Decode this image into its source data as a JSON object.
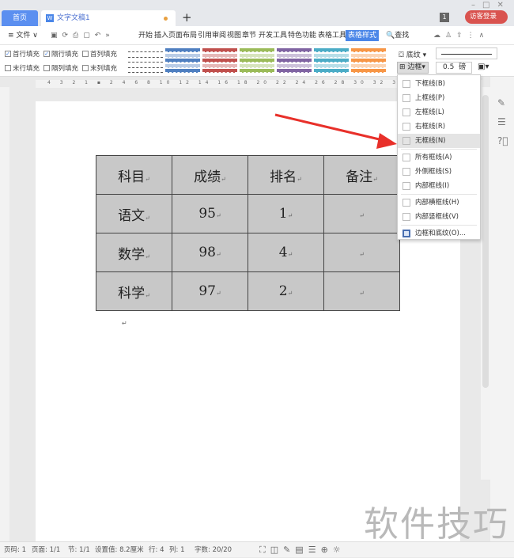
{
  "tabs": {
    "home": "首页",
    "doc": "文字文稿1",
    "new": "+"
  },
  "window": {
    "badge": "1",
    "login": "访客登录"
  },
  "menu": {
    "file": "≡ 文件 ∨",
    "items": [
      "开始",
      "插入",
      "页面布局",
      "引用",
      "审阅",
      "视图",
      "章节",
      "开发工具",
      "特色功能",
      "表格工具",
      "表格样式"
    ],
    "active": "表格样式",
    "search": "查找"
  },
  "toolbar": {
    "checks": [
      {
        "label": "首行填充",
        "checked": true
      },
      {
        "label": "隔行填充",
        "checked": true
      },
      {
        "label": "首列填充",
        "checked": false
      },
      {
        "label": "末行填充",
        "checked": false
      },
      {
        "label": "隔列填充",
        "checked": false
      },
      {
        "label": "末列填充",
        "checked": false
      }
    ],
    "style_colors": [
      "#ffffff",
      "#4f7fc0",
      "#c0504d",
      "#9bbb59",
      "#8064a2",
      "#4bacc6",
      "#f79646"
    ],
    "shading": "底纹",
    "border": "边框",
    "line_width": "0.5",
    "unit": "磅"
  },
  "table": {
    "rows": [
      [
        "科目",
        "成绩",
        "排名",
        "备注"
      ],
      [
        "语文",
        "95",
        "1",
        ""
      ],
      [
        "数学",
        "98",
        "4",
        ""
      ],
      [
        "科学",
        "97",
        "2",
        ""
      ]
    ],
    "fill": "#c8c8c8"
  },
  "paragraph_mark": "↵",
  "dropdown": {
    "items": [
      {
        "label": "下框线(B)"
      },
      {
        "label": "上框线(P)"
      },
      {
        "label": "左框线(L)"
      },
      {
        "label": "右框线(R)"
      },
      {
        "label": "无框线(N)",
        "highlighted": true
      },
      {
        "label": "所有框线(A)"
      },
      {
        "label": "外侧框线(S)"
      },
      {
        "label": "内部框线(I)"
      },
      {
        "label": "内部横框线(H)"
      },
      {
        "label": "内部竖框线(V)"
      },
      {
        "label": "边框和底纹(O)..."
      }
    ]
  },
  "annotation": {
    "arrow_color": "#e8302a"
  },
  "status": {
    "page": "页码: 1",
    "pages": "页面: 1/1",
    "section": "节: 1/1",
    "setting": "设置值: 8.2厘米",
    "row": "行: 4",
    "col": "列: 1",
    "words": "字数: 20/20"
  },
  "watermark": "软件技巧"
}
